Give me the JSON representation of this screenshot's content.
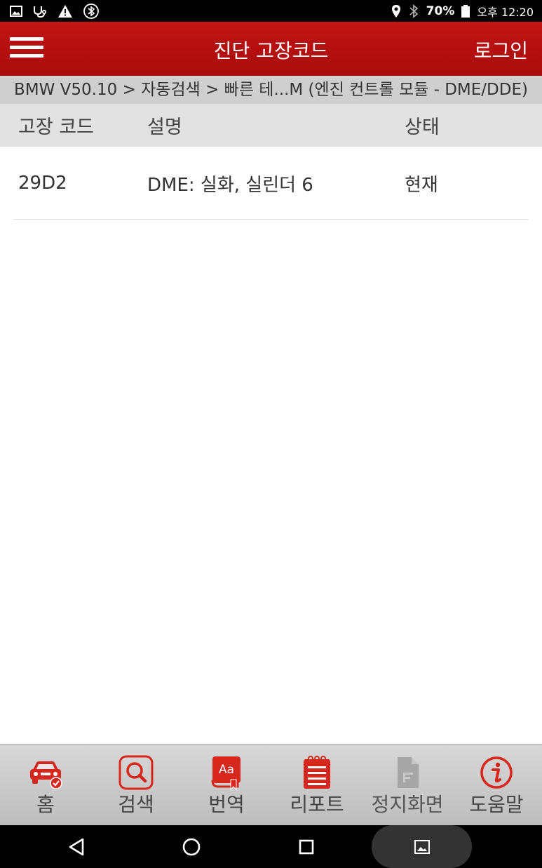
{
  "status_bar": {
    "battery": "70%",
    "time": "오후 12:20",
    "icons": [
      "gallery-icon",
      "stethoscope-icon",
      "warning-icon",
      "bluetooth-circle-icon",
      "location-icon",
      "bluetooth-icon",
      "battery-icon"
    ]
  },
  "app_bar": {
    "title": "진단 고장코드",
    "login_label": "로그인",
    "menu_icon": "menu-icon"
  },
  "breadcrumb": "BMW V50.10 > 자동검색 > 빠른 테...M (엔진 컨트롤 모듈 - DME/DDE)",
  "table": {
    "headers": {
      "code": "고장 코드",
      "description": "설명",
      "status": "상태"
    },
    "rows": [
      {
        "code": "29D2",
        "description": "DME: 실화, 실린더 6",
        "status": "현재"
      }
    ]
  },
  "bottom_nav": {
    "items": [
      {
        "label": "홈",
        "icon": "car-check-icon"
      },
      {
        "label": "검색",
        "icon": "search-icon"
      },
      {
        "label": "번역",
        "icon": "translate-icon"
      },
      {
        "label": "리포트",
        "icon": "report-icon"
      },
      {
        "label": "정지화면",
        "icon": "freeze-frame-icon",
        "enabled": false
      },
      {
        "label": "도움말",
        "icon": "info-icon"
      }
    ]
  },
  "colors": {
    "brand_red": "#b71010",
    "icon_red": "#d7261c",
    "disabled_gray": "#9a9a9a"
  }
}
